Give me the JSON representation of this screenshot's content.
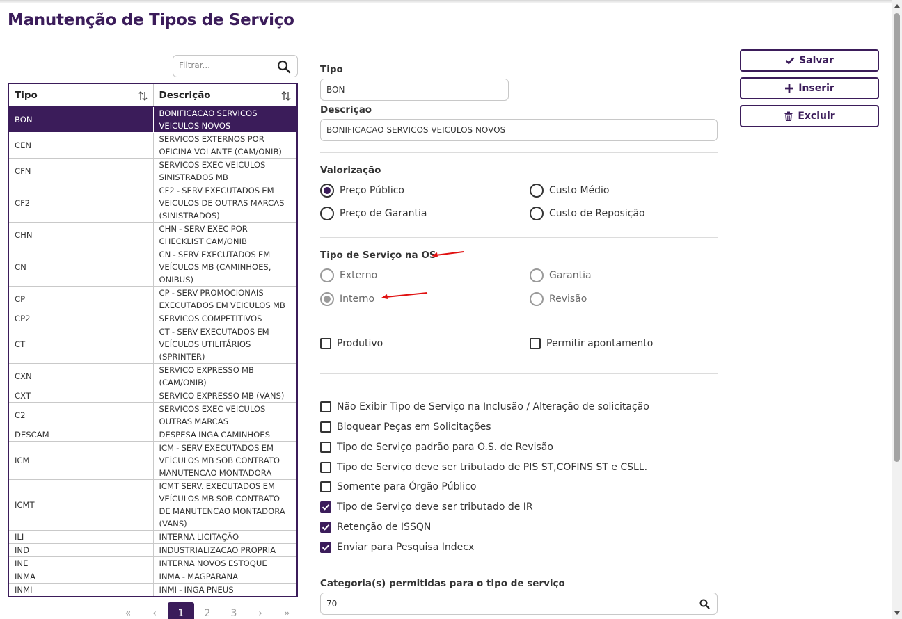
{
  "page": {
    "title": "Manutenção de Tipos de Serviço"
  },
  "filter": {
    "placeholder": "Filtrar...",
    "icon": "search-icon"
  },
  "table": {
    "headers": [
      "Tipo",
      "Descrição"
    ],
    "rows": [
      {
        "tipo": "BON",
        "descricao": "BONIFICACAO SERVICOS VEICULOS NOVOS",
        "selected": true
      },
      {
        "tipo": "CEN",
        "descricao": "SERVICOS EXTERNOS POR OFICINA VOLANTE (CAM/ONIB)"
      },
      {
        "tipo": "CFN",
        "descricao": "SERVICOS EXEC VEICULOS SINISTRADOS MB"
      },
      {
        "tipo": "CF2",
        "descricao": "CF2 - SERV EXECUTADOS EM VEICULOS DE OUTRAS MARCAS (SINISTRADOS)"
      },
      {
        "tipo": "CHN",
        "descricao": "CHN - SERV EXEC POR CHECKLIST CAM/ONIB"
      },
      {
        "tipo": "CN",
        "descricao": "CN - SERV EXECUTADOS EM VEÍCULOS MB (CAMINHOES, ONIBUS)"
      },
      {
        "tipo": "CP",
        "descricao": "CP - SERV PROMOCIONAIS EXECUTADOS EM VEICULOS MB"
      },
      {
        "tipo": "CP2",
        "descricao": "SERVICOS COMPETITIVOS"
      },
      {
        "tipo": "CT",
        "descricao": "CT - SERV EXECUTADOS EM VEÍCULOS UTILITÁRIOS (SPRINTER)"
      },
      {
        "tipo": "CXN",
        "descricao": "SERVICO EXPRESSO MB (CAM/ONIB)"
      },
      {
        "tipo": "CXT",
        "descricao": "SERVICO EXPRESSO MB (VANS)"
      },
      {
        "tipo": "C2",
        "descricao": "SERVICOS EXEC VEICULOS OUTRAS MARCAS"
      },
      {
        "tipo": "DESCAM",
        "descricao": "DESPESA INGA CAMINHOES"
      },
      {
        "tipo": "ICM",
        "descricao": "ICM - SERV EXECUTADOS EM VEÍCULOS MB SOB CONTRATO MANUTENCAO MONTADORA"
      },
      {
        "tipo": "ICMT",
        "descricao": "ICMT SERV. EXECUTADOS EM VEÍCULOS MB SOB CONTRATO DE MANUTENCAO MONTADORA (VANS)"
      },
      {
        "tipo": "ILI",
        "descricao": "INTERNA LICITAÇÃO"
      },
      {
        "tipo": "IND",
        "descricao": "INDUSTRIALIZACAO PROPRIA"
      },
      {
        "tipo": "INE",
        "descricao": "INTERNA NOVOS ESTOQUE"
      },
      {
        "tipo": "INMA",
        "descricao": "INMA - MAGPARANA"
      },
      {
        "tipo": "INMI",
        "descricao": "INMI - INGA PNEUS"
      }
    ]
  },
  "pagination": {
    "first": "«",
    "prev": "‹",
    "pages": [
      "1",
      "2",
      "3"
    ],
    "current": "1",
    "next": "›",
    "last": "»"
  },
  "form": {
    "tipo_label": "Tipo",
    "tipo_value": "BON",
    "descricao_label": "Descrição",
    "descricao_value": "BONIFICACAO SERVICOS VEICULOS NOVOS",
    "valorizacao": {
      "label": "Valorização",
      "options": [
        "Preço Público",
        "Custo Médio",
        "Preço de Garantia",
        "Custo de Reposição"
      ],
      "selected": "Preço Público"
    },
    "tipo_servico_os": {
      "label": "Tipo de Serviço na OS",
      "options": [
        "Externo",
        "Garantia",
        "Interno",
        "Revisão"
      ],
      "selected": "Interno",
      "disabled": true
    },
    "produtivo": {
      "label": "Produtivo",
      "checked": false
    },
    "permitir_apontamento": {
      "label": "Permitir apontamento",
      "checked": false
    },
    "checkboxes": [
      {
        "label": "Não Exibir Tipo de Serviço na Inclusão / Alteração de solicitação",
        "checked": false
      },
      {
        "label": "Bloquear Peças em Solicitações",
        "checked": false
      },
      {
        "label": "Tipo de Serviço padrão para O.S. de Revisão",
        "checked": false
      },
      {
        "label": "Tipo de Serviço deve ser tributado de PIS ST,COFINS ST e CSLL.",
        "checked": false
      },
      {
        "label": "Somente para Órgão Público",
        "checked": false
      },
      {
        "label": "Tipo de Serviço deve ser tributado de IR",
        "checked": true
      },
      {
        "label": "Retenção de ISSQN",
        "checked": true
      },
      {
        "label": "Enviar para Pesquisa Indecx",
        "checked": true
      }
    ],
    "categorias_label": "Categoria(s) permitidas para o tipo de serviço",
    "categorias_value": "70"
  },
  "actions": {
    "save": "Salvar",
    "insert": "Inserir",
    "delete": "Excluir"
  },
  "colors": {
    "primary": "#3b1c5a",
    "annotation_arrow": "#e01010"
  }
}
